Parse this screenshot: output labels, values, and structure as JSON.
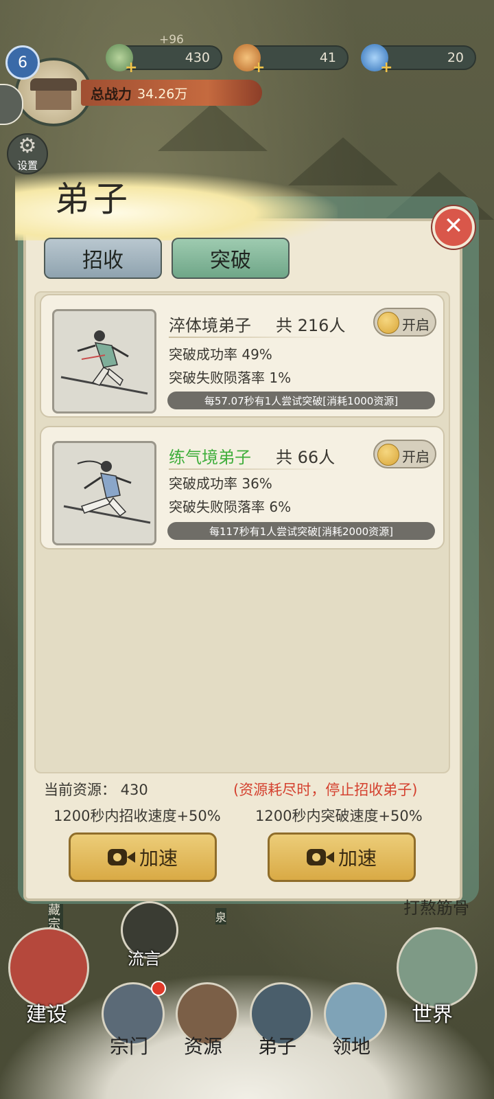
{
  "hud": {
    "level": "6",
    "power_label": "总战力",
    "power_value": "34.26万",
    "resource_delta": "+96",
    "resources": [
      {
        "name": "spirit-stone",
        "value": "430",
        "color": "#7fa673"
      },
      {
        "name": "ore",
        "value": "41",
        "color": "#d88a3c"
      },
      {
        "name": "crystal",
        "value": "20",
        "color": "#4a8fd8"
      }
    ],
    "settings_label": "设置"
  },
  "panel": {
    "title": "弟子",
    "tabs": [
      {
        "label": "招收",
        "active": false
      },
      {
        "label": "突破",
        "active": true
      }
    ],
    "cards": [
      {
        "name": "淬体境弟子",
        "count": "共 216人",
        "success_rate": "突破成功率 49%",
        "fall_rate": "突破失败陨落率 1%",
        "toggle_label": "开启",
        "info": "每57.07秒有1人尝试突破[消耗1000资源]",
        "name_color": "#3a3832"
      },
      {
        "name": "练气境弟子",
        "count": "共 66人",
        "success_rate": "突破成功率 36%",
        "fall_rate": "突破失败陨落率 6%",
        "toggle_label": "开启",
        "info": "每117秒有1人尝试突破[消耗2000资源]",
        "name_color": "#3fae3b"
      }
    ],
    "current_resource": "当前资源： 430",
    "warning": "(资源耗尽时，停止招收弟子)",
    "recruit_bonus": "1200秒内招收速度+50%",
    "break_bonus": "1200秒内突破速度+50%",
    "speed_button_label": "加速"
  },
  "map_labels": {
    "rumor": "流言",
    "right_top": "打熬筋骨",
    "cang": "藏宗",
    "quan": "泉"
  },
  "nav": {
    "build": "建设",
    "world": "世界",
    "items": [
      "宗门",
      "资源",
      "弟子",
      "领地"
    ]
  }
}
